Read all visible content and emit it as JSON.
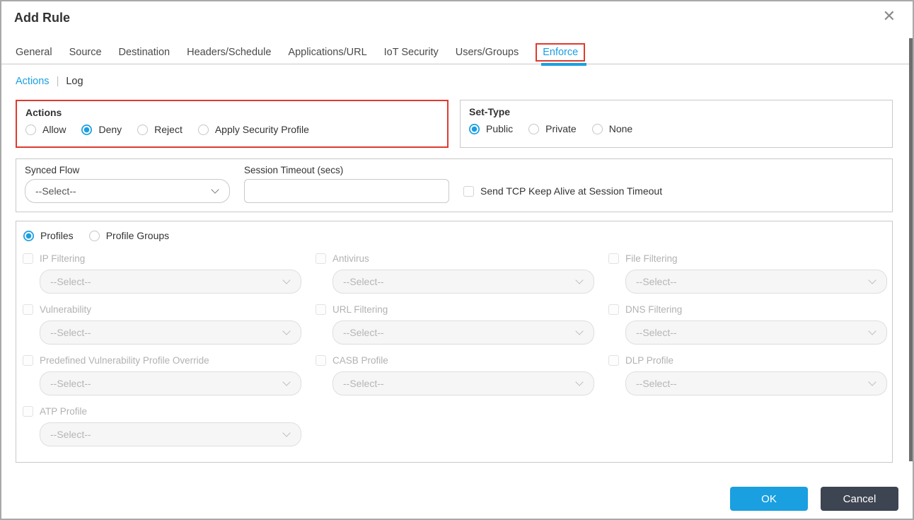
{
  "dialog": {
    "title": "Add Rule",
    "close_icon": "✕"
  },
  "tabs": [
    {
      "label": "General",
      "active": false
    },
    {
      "label": "Source",
      "active": false
    },
    {
      "label": "Destination",
      "active": false
    },
    {
      "label": "Headers/Schedule",
      "active": false
    },
    {
      "label": "Applications/URL",
      "active": false
    },
    {
      "label": "IoT Security",
      "active": false
    },
    {
      "label": "Users/Groups",
      "active": false
    },
    {
      "label": "Enforce",
      "active": true,
      "annotated": true
    }
  ],
  "subnav": {
    "actions": "Actions",
    "separator": "|",
    "log": "Log"
  },
  "actions_section": {
    "title": "Actions",
    "options": [
      {
        "label": "Allow",
        "selected": false
      },
      {
        "label": "Deny",
        "selected": true
      },
      {
        "label": "Reject",
        "selected": false
      },
      {
        "label": "Apply Security Profile",
        "selected": false
      }
    ]
  },
  "set_type_section": {
    "title": "Set-Type",
    "options": [
      {
        "label": "Public",
        "selected": true
      },
      {
        "label": "Private",
        "selected": false
      },
      {
        "label": "None",
        "selected": false
      }
    ]
  },
  "flow_section": {
    "synced_flow_label": "Synced Flow",
    "synced_flow_value": "--Select--",
    "session_timeout_label": "Session Timeout (secs)",
    "session_timeout_value": "",
    "tcp_keep_alive_label": "Send TCP Keep Alive at Session Timeout",
    "tcp_keep_alive_checked": false
  },
  "profiles_section": {
    "mode_options": [
      {
        "label": "Profiles",
        "selected": true
      },
      {
        "label": "Profile Groups",
        "selected": false
      }
    ],
    "fields": [
      {
        "label": "IP Filtering",
        "value": "--Select--",
        "checked": false
      },
      {
        "label": "Antivirus",
        "value": "--Select--",
        "checked": false
      },
      {
        "label": "File Filtering",
        "value": "--Select--",
        "checked": false
      },
      {
        "label": "Vulnerability",
        "value": "--Select--",
        "checked": false
      },
      {
        "label": "URL Filtering",
        "value": "--Select--",
        "checked": false
      },
      {
        "label": "DNS Filtering",
        "value": "--Select--",
        "checked": false
      },
      {
        "label": "Predefined Vulnerability Profile Override",
        "value": "--Select--",
        "checked": false
      },
      {
        "label": "CASB Profile",
        "value": "--Select--",
        "checked": false
      },
      {
        "label": "DLP Profile",
        "value": "--Select--",
        "checked": false
      },
      {
        "label": "ATP Profile",
        "value": "--Select--",
        "checked": false
      }
    ]
  },
  "footer": {
    "ok_label": "OK",
    "cancel_label": "Cancel"
  },
  "colors": {
    "accent_blue": "#1a9fe0",
    "annotation_red": "#e03a2e",
    "cancel_dark": "#3d4452",
    "scrollbar_gray": "#6e6e6e"
  }
}
